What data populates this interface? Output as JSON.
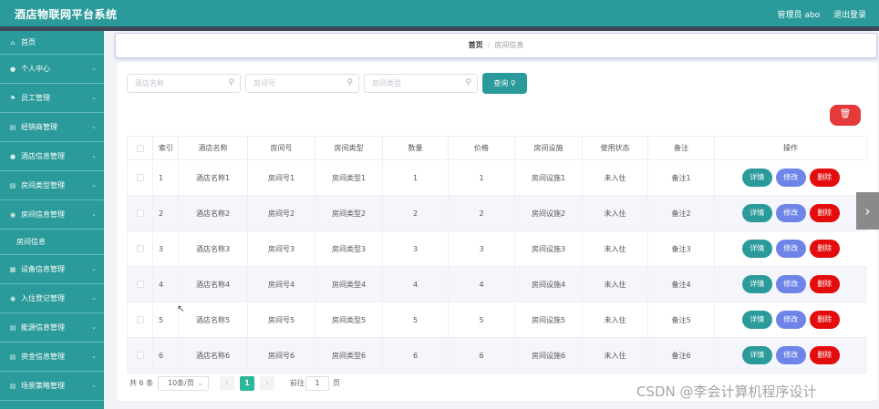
{
  "header": {
    "title": "酒店物联网平台系统",
    "user": "管理员 abo",
    "logout": "退出登录"
  },
  "sidebar": {
    "items": [
      {
        "label": "首页",
        "icon": "home-icon",
        "glyph": "⌂"
      },
      {
        "label": "个人中心",
        "icon": "user-icon",
        "glyph": "●"
      },
      {
        "label": "员工管理",
        "icon": "flag-icon",
        "glyph": "⚑"
      },
      {
        "label": "经销商管理",
        "icon": "document-icon",
        "glyph": "▤"
      },
      {
        "label": "酒店信息管理",
        "icon": "user-icon",
        "glyph": "●"
      },
      {
        "label": "房间类型管理",
        "icon": "document-icon",
        "glyph": "▤"
      },
      {
        "label": "房间信息管理",
        "icon": "location-icon",
        "glyph": "◉"
      }
    ],
    "sub_item": "房间信息",
    "items_after": [
      {
        "label": "设备信息管理",
        "icon": "grid-icon",
        "glyph": "▦"
      },
      {
        "label": "入住登记管理",
        "icon": "location-icon",
        "glyph": "◉"
      },
      {
        "label": "能源信息管理",
        "icon": "document-icon",
        "glyph": "▤"
      },
      {
        "label": "资金信息管理",
        "icon": "document-icon",
        "glyph": "▤"
      },
      {
        "label": "场景策略管理",
        "icon": "document-icon",
        "glyph": "▤"
      }
    ]
  },
  "breadcrumb": {
    "home": "首页",
    "separator": "/",
    "current": "房间信息"
  },
  "search": {
    "hotel_placeholder": "酒店名称",
    "room_no_placeholder": "房间号",
    "room_type_placeholder": "房间类型",
    "button": "查询"
  },
  "table": {
    "headers": [
      "索引",
      "酒店名称",
      "房间号",
      "房间类型",
      "数量",
      "价格",
      "房间设施",
      "使用状态",
      "备注",
      "操作"
    ],
    "rows": [
      {
        "index": "1",
        "hotel": "酒店名称1",
        "room_no": "房间号1",
        "room_type": "房间类型1",
        "qty": "1",
        "price": "1",
        "facility": "房间设施1",
        "status": "未入住",
        "note": "备注1"
      },
      {
        "index": "2",
        "hotel": "酒店名称2",
        "room_no": "房间号2",
        "room_type": "房间类型2",
        "qty": "2",
        "price": "2",
        "facility": "房间设施2",
        "status": "未入住",
        "note": "备注2"
      },
      {
        "index": "3",
        "hotel": "酒店名称3",
        "room_no": "房间号3",
        "room_type": "房间类型3",
        "qty": "3",
        "price": "3",
        "facility": "房间设施3",
        "status": "未入住",
        "note": "备注3"
      },
      {
        "index": "4",
        "hotel": "酒店名称4",
        "room_no": "房间号4",
        "room_type": "房间类型4",
        "qty": "4",
        "price": "4",
        "facility": "房间设施4",
        "status": "未入住",
        "note": "备注4"
      },
      {
        "index": "5",
        "hotel": "酒店名称5",
        "room_no": "房间号5",
        "room_type": "房间类型5",
        "qty": "5",
        "price": "5",
        "facility": "房间设施5",
        "status": "未入住",
        "note": "备注5"
      },
      {
        "index": "6",
        "hotel": "酒店名称6",
        "room_no": "房间号6",
        "room_type": "房间类型6",
        "qty": "6",
        "price": "6",
        "facility": "房间设施6",
        "status": "未入住",
        "note": "备注6"
      }
    ],
    "actions": {
      "detail": "详情",
      "edit": "修改",
      "delete": "删除"
    }
  },
  "pagination": {
    "total": "共 6 条",
    "page_size": "10条/页",
    "current_page": "1",
    "goto_label": "前往",
    "goto_value": "1",
    "goto_suffix": "页"
  },
  "watermark": "CSDN @李会计算机程序设计",
  "colors": {
    "primary": "#2a9a9a",
    "edit": "#6f84e8",
    "danger": "#e40c0c",
    "page_active": "#2bb89a"
  }
}
